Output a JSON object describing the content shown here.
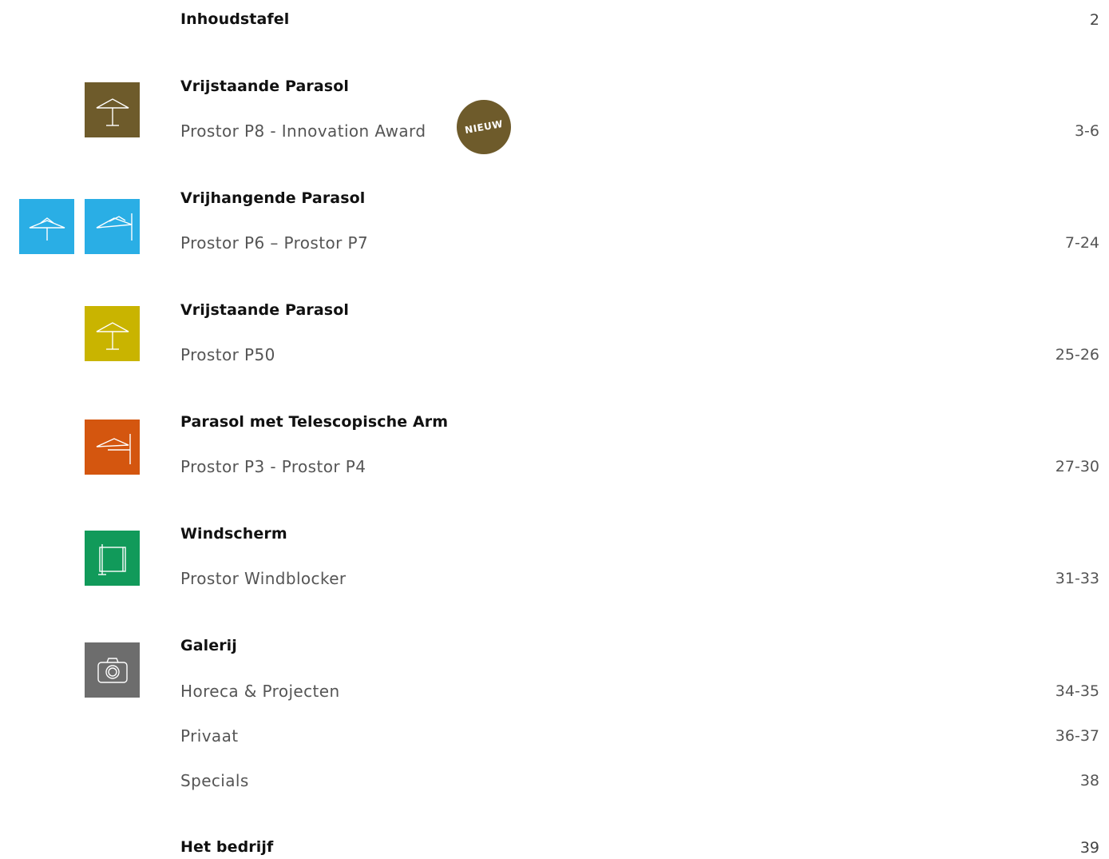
{
  "colors": {
    "olive": "#6e5b2b",
    "blue": "#2aaee5",
    "yellow": "#c9b400",
    "orange": "#d4560f",
    "green": "#119a5a",
    "grey": "#6d6d6d"
  },
  "toc": {
    "title": "Inhoudstafel",
    "title_page": "2",
    "sections": [
      {
        "heading": "Vrijstaande Parasol",
        "icon": "freestanding-parasol-icon",
        "entries": [
          {
            "label": "Prostor P8 - Innovation Award",
            "pages": "3-6"
          }
        ],
        "badge": "NIEUW"
      },
      {
        "heading": "Vrijhangende Parasol",
        "icon": "cantilever-parasol-icon",
        "entries": [
          {
            "label": "Prostor P6 – Prostor P7",
            "pages": "7-24"
          }
        ]
      },
      {
        "heading": "Vrijstaande Parasol",
        "icon": "freestanding-parasol-icon",
        "entries": [
          {
            "label": "Prostor P50",
            "pages": "25-26"
          }
        ]
      },
      {
        "heading": "Parasol met Telescopische Arm",
        "icon": "telescopic-arm-parasol-icon",
        "entries": [
          {
            "label": "Prostor P3 - Prostor P4",
            "pages": "27-30"
          }
        ]
      },
      {
        "heading": "Windscherm",
        "icon": "windscreen-icon",
        "entries": [
          {
            "label": "Prostor Windblocker",
            "pages": "31-33"
          }
        ]
      },
      {
        "heading": "Galerij",
        "icon": "camera-icon",
        "entries": [
          {
            "label": "Horeca & Projecten",
            "pages": "34-35"
          },
          {
            "label": "Privaat",
            "pages": "36-37"
          },
          {
            "label": "Specials",
            "pages": "38"
          }
        ]
      }
    ],
    "footer_heading": "Het bedrijf",
    "footer_page": "39"
  }
}
